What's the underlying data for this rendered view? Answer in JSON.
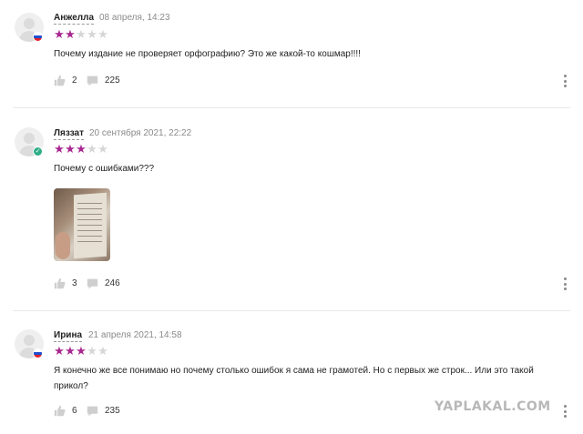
{
  "colors": {
    "star_on": "#a8278f",
    "star_off": "#d6d6d6",
    "badge": "#2fae88"
  },
  "reviews": [
    {
      "author": "Анжелла",
      "date": "08 апреля, 14:23",
      "rating": 2,
      "max_rating": 5,
      "text": "Почему издание не проверяет орфографию? Это же какой-то кошмар!!!!",
      "likes": "2",
      "comments": "225",
      "flag": "ru"
    },
    {
      "author": "Ляззат",
      "date": "20 сентября 2021, 22:22",
      "rating": 3,
      "max_rating": 5,
      "text": "Почему с ошибками???",
      "likes": "3",
      "comments": "246",
      "flag": "badge",
      "has_photo": true
    },
    {
      "author": "Ирина",
      "date": "21 апреля 2021, 14:58",
      "rating": 3,
      "max_rating": 5,
      "text_line1": "Я конечно же все понимаю но почему столько ошибок я сама не грамотей. Но с первых же строк... Или это такой",
      "text_line2": "прикол?",
      "likes": "6",
      "comments": "235",
      "flag": "ru"
    }
  ],
  "watermark": "YAPLAKAL.COM"
}
